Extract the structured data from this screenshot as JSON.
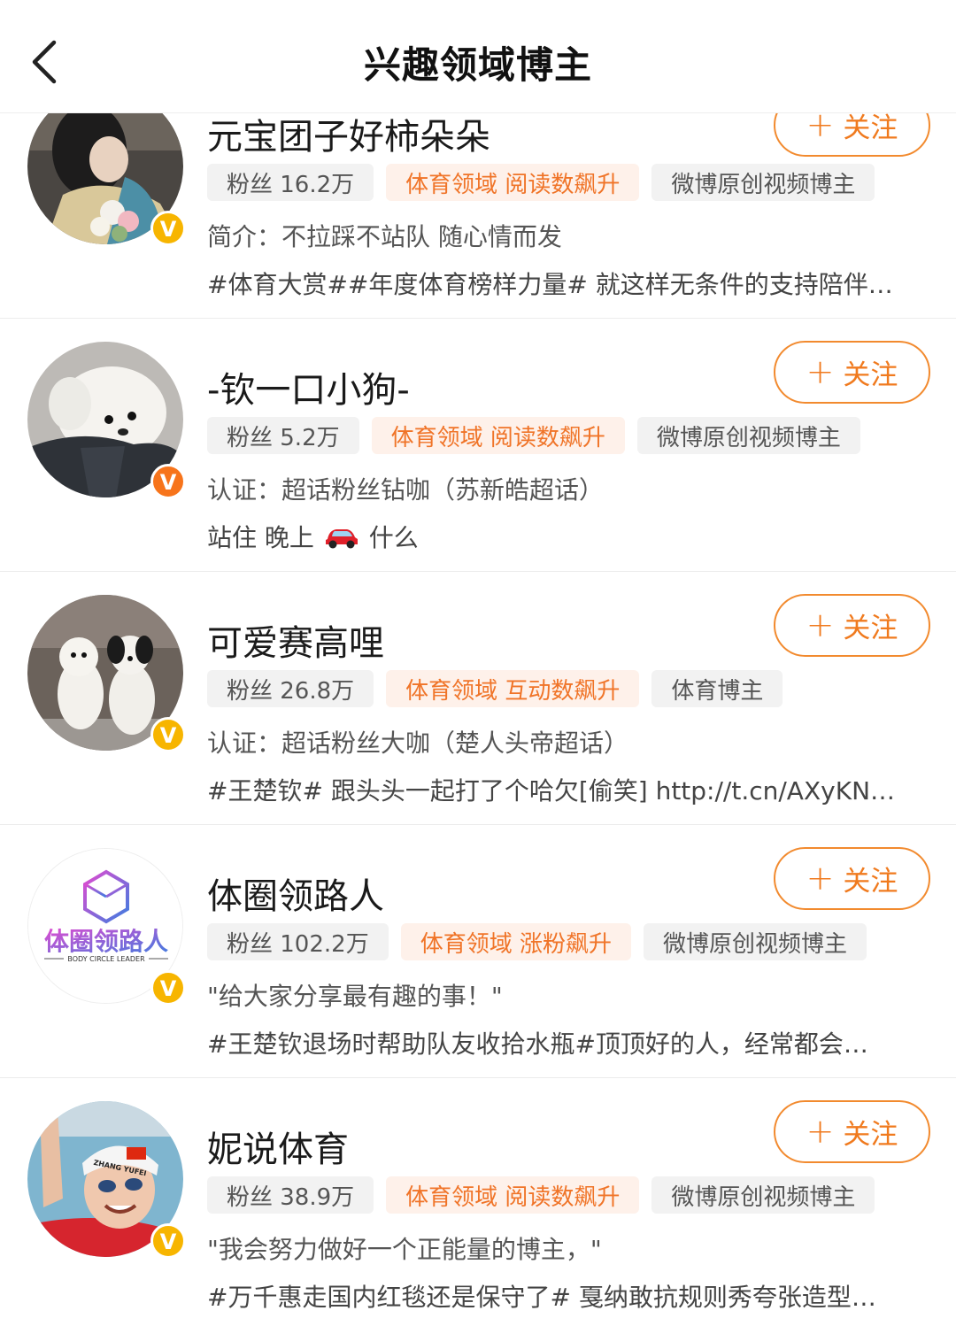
{
  "header": {
    "title": "兴趣领域博主",
    "back_icon": "chevron-left-icon"
  },
  "colors": {
    "accent": "#f07a1e",
    "hot_tag_bg": "#fef1ea",
    "gray_tag_bg": "#f2f2f2",
    "verified_gold": "#f7b500",
    "verified_orange": "#f7741b"
  },
  "follow_label": "关注",
  "verified_badge": "V",
  "bloggers": [
    {
      "name": "元宝团子好柿朵朵",
      "fans": "粉丝 16.2万",
      "hot_tag": "体育领域 阅读数飙升",
      "type_tag": "微博原创视频博主",
      "desc": "简介：不拉踩不站队 随心情而发",
      "recent": "#体育大赏##年度体育榜样力量# 就这样无条件的支持陪伴…",
      "badge_color": "gold"
    },
    {
      "name": "-钦一口小狗-",
      "fans": "粉丝 5.2万",
      "hot_tag": "体育领域 阅读数飙升",
      "type_tag": "微博原创视频博主",
      "desc": "认证：超话粉丝钻咖（苏新皓超话）",
      "recent_before": "站住 晚上",
      "recent_after": "什么",
      "recent_emoji": "car-icon",
      "badge_color": "orange"
    },
    {
      "name": "可爱赛高哩",
      "fans": "粉丝 26.8万",
      "hot_tag": "体育领域 互动数飙升",
      "type_tag": "体育博主",
      "desc": "认证：超话粉丝大咖（楚人头帝超话）",
      "recent": "#王楚钦# 跟头头一起打了个哈欠[偷笑] http://t.cn/AXyKN…",
      "badge_color": "gold"
    },
    {
      "name": "体圈领路人",
      "fans": "粉丝 102.2万",
      "hot_tag": "体育领域 涨粉飙升",
      "type_tag": "微博原创视频博主",
      "desc": "\"给大家分享最有趣的事！\"",
      "recent": "#王楚钦退场时帮助队友收拾水瓶#顶顶好的人，经常都会…",
      "logo_text": "体圈领路人",
      "logo_sub": "BODY CIRCLE LEADER",
      "badge_color": "gold"
    },
    {
      "name": "妮说体育",
      "fans": "粉丝 38.9万",
      "hot_tag": "体育领域 阅读数飙升",
      "type_tag": "微博原创视频博主",
      "desc": "\"我会努力做好一个正能量的博主，\"",
      "recent": "#万千惠走国内红毯还是保守了# 戛纳敢抗规则秀夸张造型…",
      "cap_text": "ZHANG YUFEI",
      "badge_color": "gold"
    }
  ]
}
